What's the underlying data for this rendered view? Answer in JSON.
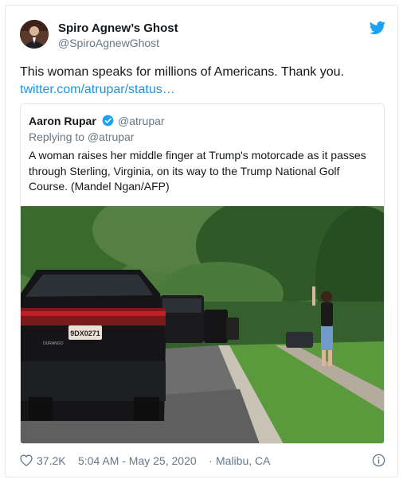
{
  "tweet": {
    "author_name": "Spiro Agnew’s Ghost",
    "author_handle": "@SpiroAgnewGhost",
    "text": "This woman speaks for millions of Americans. Thank you.",
    "link": "twitter.com/atrupar/status…"
  },
  "quoted": {
    "author_name": "Aaron Rupar",
    "author_handle": "@atrupar",
    "replying_to": "Replying to @atrupar",
    "text": "A woman raises her middle finger at Trump's motorcade as it passes through Sterling, Virginia, on its way to the Trump National Golf Course. (Mandel Ngan/AFP)",
    "photo": {
      "plate_text": "9DX0271",
      "vehicle_badge": "DURANGO"
    }
  },
  "footer": {
    "likes": "37.2K",
    "timestamp": "5:04 AM - May 25, 2020",
    "separator": "·",
    "location": "Malibu, CA"
  },
  "colors": {
    "link": "#1b95e0",
    "bird": "#1da1f2",
    "text": "#14171a",
    "muted": "#657786",
    "border": "#e1e8ed"
  },
  "icons": [
    "twitter-bird-icon",
    "verified-badge-icon",
    "heart-icon",
    "info-icon"
  ]
}
